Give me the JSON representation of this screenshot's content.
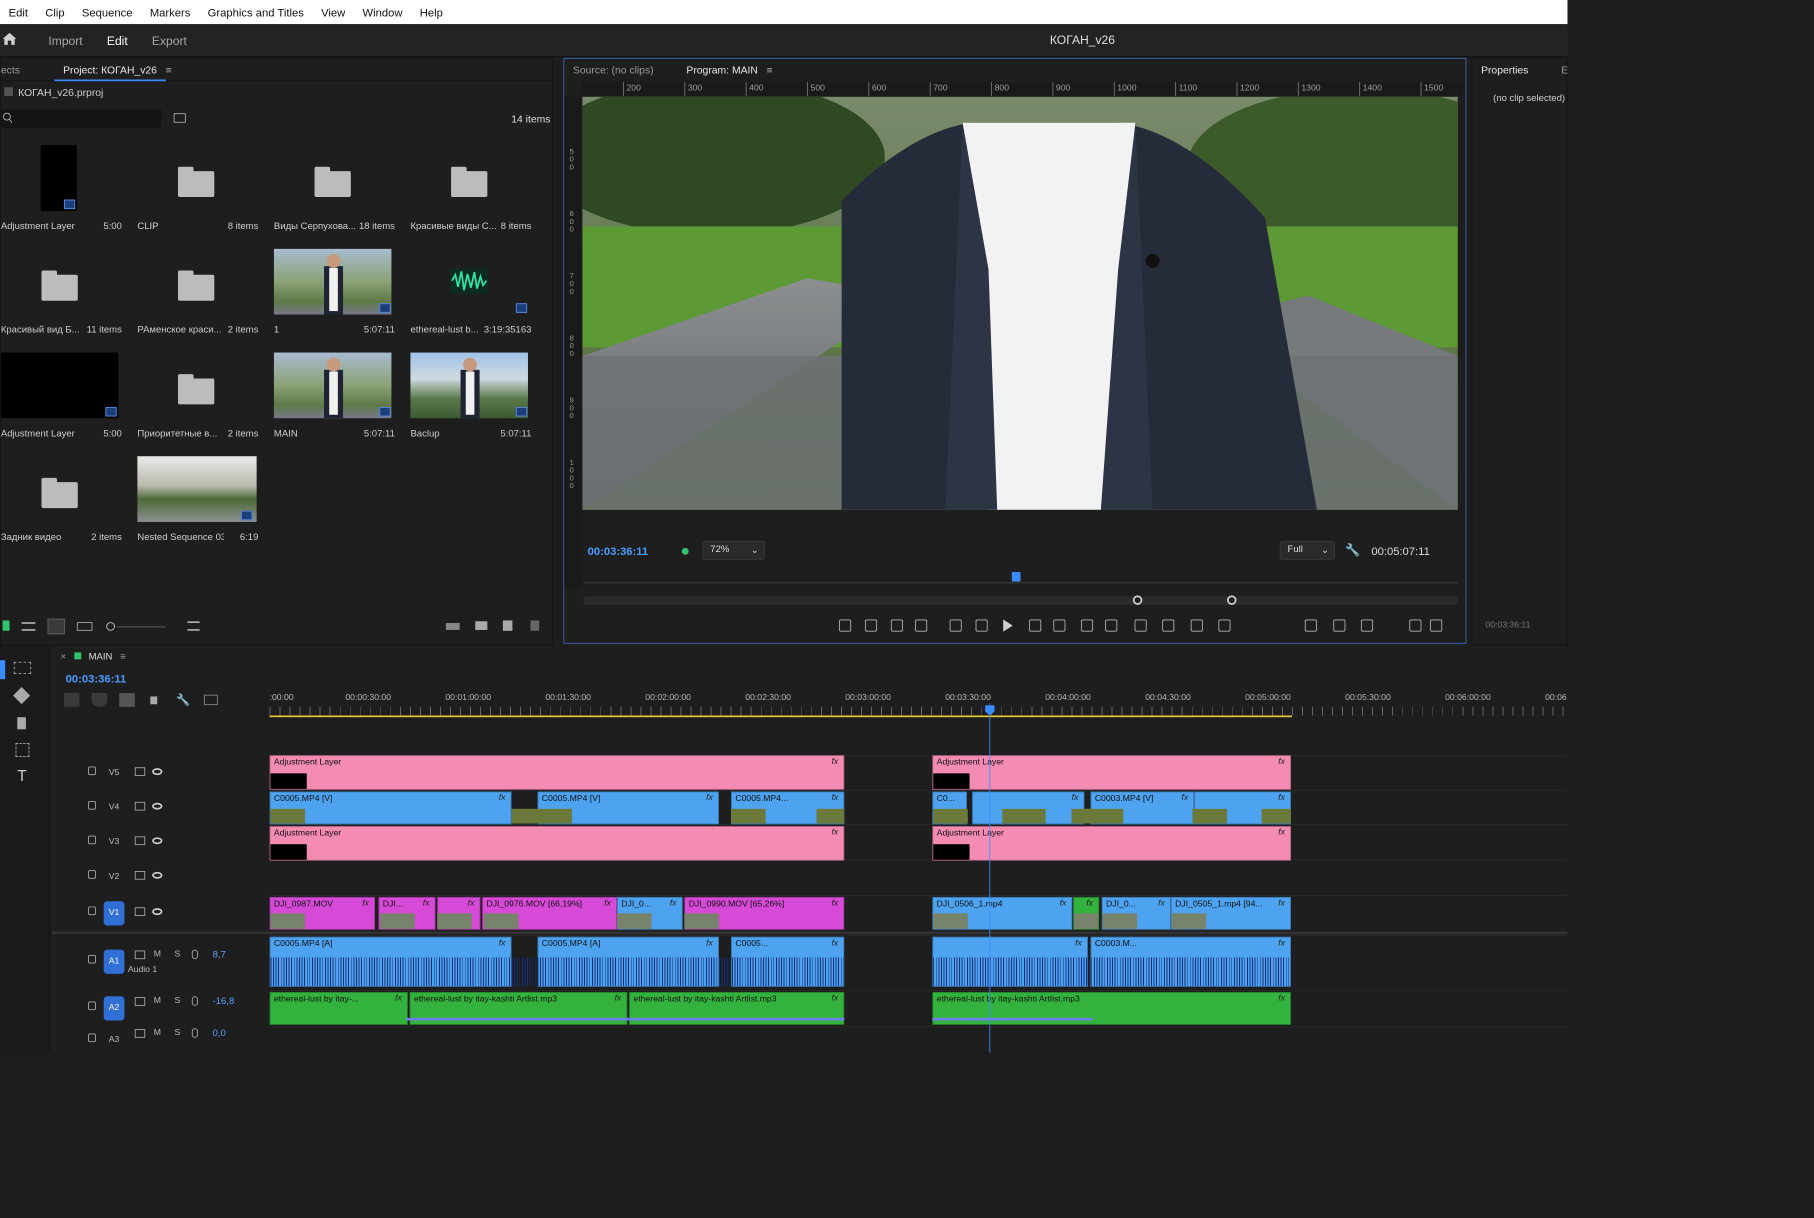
{
  "menu": [
    "Edit",
    "Clip",
    "Sequence",
    "Markers",
    "Graphics and Titles",
    "View",
    "Window",
    "Help"
  ],
  "workspace": {
    "tabs": [
      "Import",
      "Edit",
      "Export"
    ],
    "active": "Edit",
    "doc_title": "КОГАН_v26"
  },
  "project": {
    "tab_prev": "ects",
    "tab": "Project: КОГАН_v26",
    "file": "КОГАН_v26.prproj",
    "count": "14 items",
    "items": [
      {
        "label": "Adjustment Layer",
        "meta": "5:00"
      },
      {
        "label": "CLIP",
        "meta": "8 items"
      },
      {
        "label": "Виды Серпухова...",
        "meta": "18 items"
      },
      {
        "label": "Красивые виды С...",
        "meta": "8 items"
      },
      {
        "label": "Красивый вид Б...",
        "meta": "11 items"
      },
      {
        "label": "РАменское краси...",
        "meta": "2 items"
      },
      {
        "label": "1",
        "meta": "5:07:11"
      },
      {
        "label": "ethereal-lust b...",
        "meta": "3:19:35163"
      },
      {
        "label": "Adjustment Layer",
        "meta": "5:00"
      },
      {
        "label": "Приоритетные в...",
        "meta": "2 items"
      },
      {
        "label": "MAIN",
        "meta": "5:07:11"
      },
      {
        "label": "Baclup",
        "meta": "5:07:11"
      },
      {
        "label": "Задник видео",
        "meta": "2 items"
      },
      {
        "label": "Nested Sequence 03",
        "meta": "6:19"
      }
    ]
  },
  "source_tab": "Source: (no clips)",
  "program": {
    "tab": "Program: MAIN",
    "ruler": [
      "200",
      "300",
      "400",
      "500",
      "600",
      "700",
      "800",
      "900",
      "1000",
      "1100",
      "1200",
      "1300",
      "1400",
      "1500"
    ],
    "vruler": [
      "500",
      "600",
      "700",
      "800",
      "900",
      "1000"
    ],
    "timecode": "00:03:36:11",
    "zoom": "72%",
    "quality": "Full",
    "duration": "00:05:07:11"
  },
  "properties": {
    "tab": "Properties",
    "tab2": "Ef",
    "empty": "(no clip selected)",
    "tc": "00:03:36:11"
  },
  "timeline": {
    "tab": "MAIN",
    "timecode": "00:03:36:11",
    "ruler": [
      ":00:00",
      "00:00:30:00",
      "00:01:00:00",
      "00:01:30:00",
      "00:02:00:00",
      "00:02:30:00",
      "00:03:00:00",
      "00:03:30:00",
      "00:04:00:00",
      "00:04:30:00",
      "00:05:00:00",
      "00:05:30:00",
      "00:06:00:00",
      "00:06"
    ],
    "tracks": [
      "V5",
      "V4",
      "V3",
      "V2",
      "V1",
      "A1",
      "A2",
      "A3"
    ],
    "audio1_name": "Audio 1",
    "a1_vol": "8,7",
    "a2_vol": "-16,8",
    "a3_vol": "0,0",
    "clips": {
      "adj": "Adjustment Layer",
      "v4a": "C0005.MP4 [V]",
      "v4b": "C0005.MP4 [V]",
      "v4c": "C0005.MP4...",
      "v4d": "C0...",
      "v4e": "C0003.MP4 [V]",
      "v1a": "DJI_0987.MOV",
      "v1b": "DJI...",
      "v1c": "DJI_0976.MOV [66,19%]",
      "v1d": "DJI_0...",
      "v1e": "DJI_0990.MOV [65,26%]",
      "v1f": "DJI_0506_1.mp4",
      "v1g": "fx",
      "v1h": "DJI_0...",
      "v1i": "DJI_0505_1.mp4 [94...",
      "a1a": "C0005.MP4 [A]",
      "a1b": "C0005.MP4 [A]",
      "a1c": "C0005...",
      "a1d": "C0003.M...",
      "a2a": "ethereal-lust by itay-...",
      "a2b": "ethereal-lust by itay-kashti Artlist.mp3",
      "a2c": "ethereal-lust by itay-kashti Artlist.mp3",
      "a2d": "ethereal-lust by itay-kashti Artlist.mp3"
    }
  }
}
